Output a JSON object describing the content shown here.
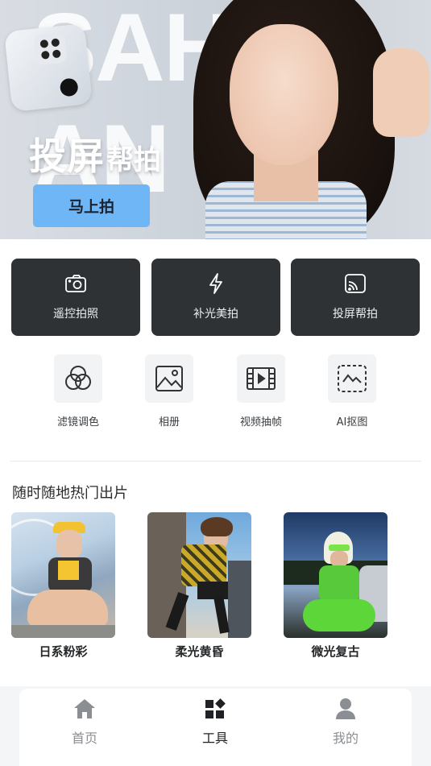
{
  "banner": {
    "bg_text": "SAHR AN",
    "title_big": "投屏",
    "title_small": "帮拍",
    "cta": "马上拍"
  },
  "main_tools": [
    {
      "label": "遥控拍照",
      "icon": "remote-camera-icon"
    },
    {
      "label": "补光美拍",
      "icon": "flash-icon"
    },
    {
      "label": "投屏帮拍",
      "icon": "cast-screen-icon"
    }
  ],
  "sub_tools": [
    {
      "label": "滤镜调色",
      "icon": "filter-circles-icon"
    },
    {
      "label": "相册",
      "icon": "album-image-icon"
    },
    {
      "label": "视频抽帧",
      "icon": "video-frame-icon"
    },
    {
      "label": "AI抠图",
      "icon": "ai-cutout-icon"
    }
  ],
  "section": {
    "title": "随时随地热门出片"
  },
  "styles": [
    {
      "label": "日系粉彩"
    },
    {
      "label": "柔光黄昏"
    },
    {
      "label": "微光复古"
    }
  ],
  "nav": [
    {
      "label": "首页",
      "icon": "home-icon",
      "active": false
    },
    {
      "label": "工具",
      "icon": "tools-grid-icon",
      "active": true
    },
    {
      "label": "我的",
      "icon": "profile-icon",
      "active": false
    }
  ],
  "colors": {
    "accent_button": "#6fb6f7",
    "card_dark": "#2f3235"
  }
}
